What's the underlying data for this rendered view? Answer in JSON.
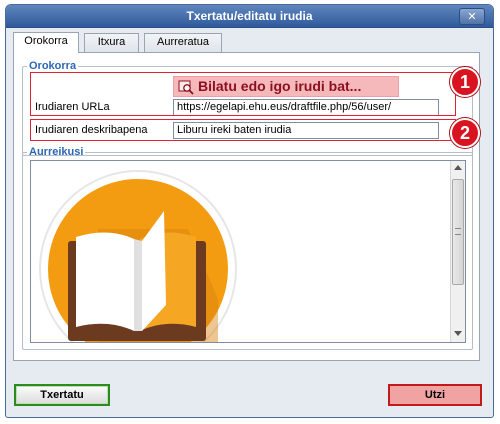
{
  "dialog": {
    "title": "Txertatu/editatu irudia",
    "close_label": "✕"
  },
  "tabs": [
    {
      "label": "Orokorra",
      "active": true
    },
    {
      "label": "Itxura",
      "active": false
    },
    {
      "label": "Aurreratua",
      "active": false
    }
  ],
  "general": {
    "legend": "Orokorra",
    "browse_label": "Bilatu edo igo irudi bat...",
    "url_label": "Irudiaren URLa",
    "url_value": "https://egelapi.ehu.eus/draftfile.php/56/user/",
    "description_label": "Irudiaren deskribapena",
    "description_value": "Liburu ireki baten irudia"
  },
  "preview": {
    "legend": "Aurreikusi"
  },
  "annotations": [
    {
      "number": "1"
    },
    {
      "number": "2"
    }
  ],
  "buttons": {
    "insert_label": "Txertatu",
    "cancel_label": "Utzi"
  },
  "colors": {
    "title_bar": "#3f69a8",
    "legend": "#2d66b5",
    "browse_bg": "#f5b9bc",
    "browse_text": "#8c0f1f",
    "highlight": "#e02234",
    "badge": "#d7141f",
    "insert_border": "#2c8a1f",
    "cancel_bg": "#f1a3a3",
    "book_circle": "#f39c12"
  },
  "icons": {
    "browse": "image-search-icon",
    "close": "close-icon",
    "preview_image": "open-book-icon"
  }
}
